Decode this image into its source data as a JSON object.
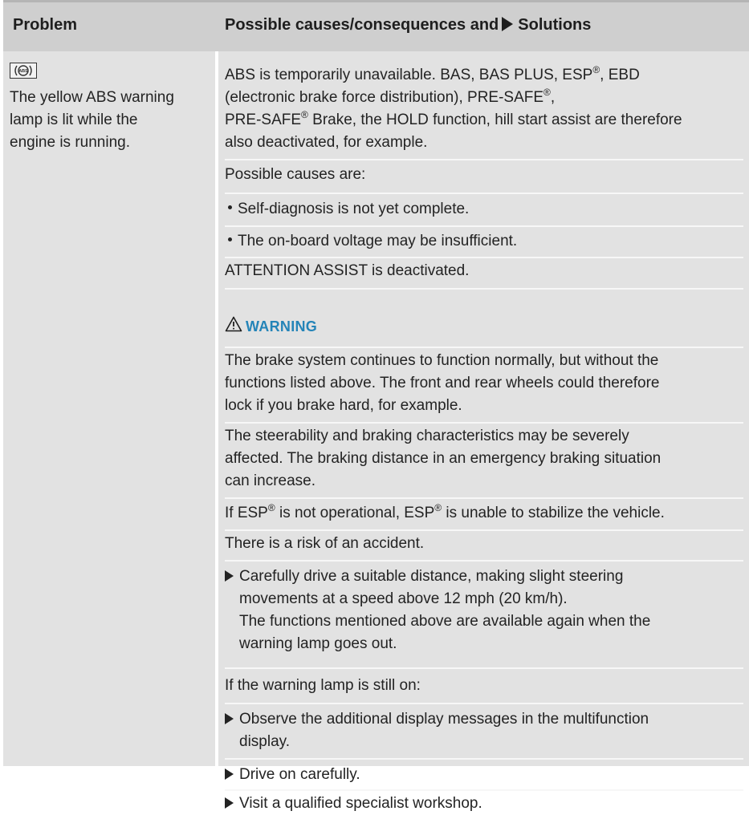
{
  "header": {
    "problem": "Problem",
    "solutions_pre": "Possible causes/consequences and",
    "solutions_post": "Solutions"
  },
  "problem": {
    "icon_label": "ABS",
    "line1": "The yellow ABS warning",
    "line2": "lamp is lit while the",
    "line3": "engine is running."
  },
  "intro": {
    "l1a": "ABS is temporarily unavailable. BAS, BAS PLUS, ESP",
    "l1b": ", EBD",
    "l2a": "(electronic brake force distribution), PRE-SAFE",
    "l2b": ",",
    "l3a": "PRE-SAFE",
    "l3b": " Brake, the HOLD function, hill start assist are therefore",
    "l4": "also deactivated, for example.",
    "reg": "®"
  },
  "causes": {
    "title": "Possible causes are:",
    "items": [
      "Self-diagnosis is not yet complete.",
      "The on-board voltage may be insufficient."
    ],
    "attention": "ATTENTION ASSIST is deactivated."
  },
  "warning": {
    "title": "WARNING",
    "p1": [
      "The brake system continues to function normally, but without the",
      "functions listed above. The front and rear wheels could therefore",
      "lock if you brake hard, for example."
    ],
    "p2": [
      "The steerability and braking characteristics may be severely",
      "affected. The braking distance in an emergency braking situation",
      "can increase."
    ],
    "p3a": "If ESP",
    "p3b": " is not operational, ESP",
    "p3c": " is unable to stabilize the vehicle.",
    "p4": "There is a risk of an accident."
  },
  "step1": {
    "lines": [
      "Carefully drive a suitable distance, making slight steering",
      "movements at a speed above 12 mph (20 km/h).",
      "The functions mentioned above are available again when the",
      "warning lamp goes out."
    ]
  },
  "still_on": {
    "title": "If the warning lamp is still on:",
    "s1": [
      "Observe the additional display messages in the multifunction",
      "display."
    ],
    "s2": "Drive on carefully.",
    "s3": "Visit a qualified specialist workshop."
  },
  "colors": {
    "header_bg": "#cfcfcf",
    "cell_bg": "#e2e2e2",
    "warning_accent": "#2484b8"
  }
}
